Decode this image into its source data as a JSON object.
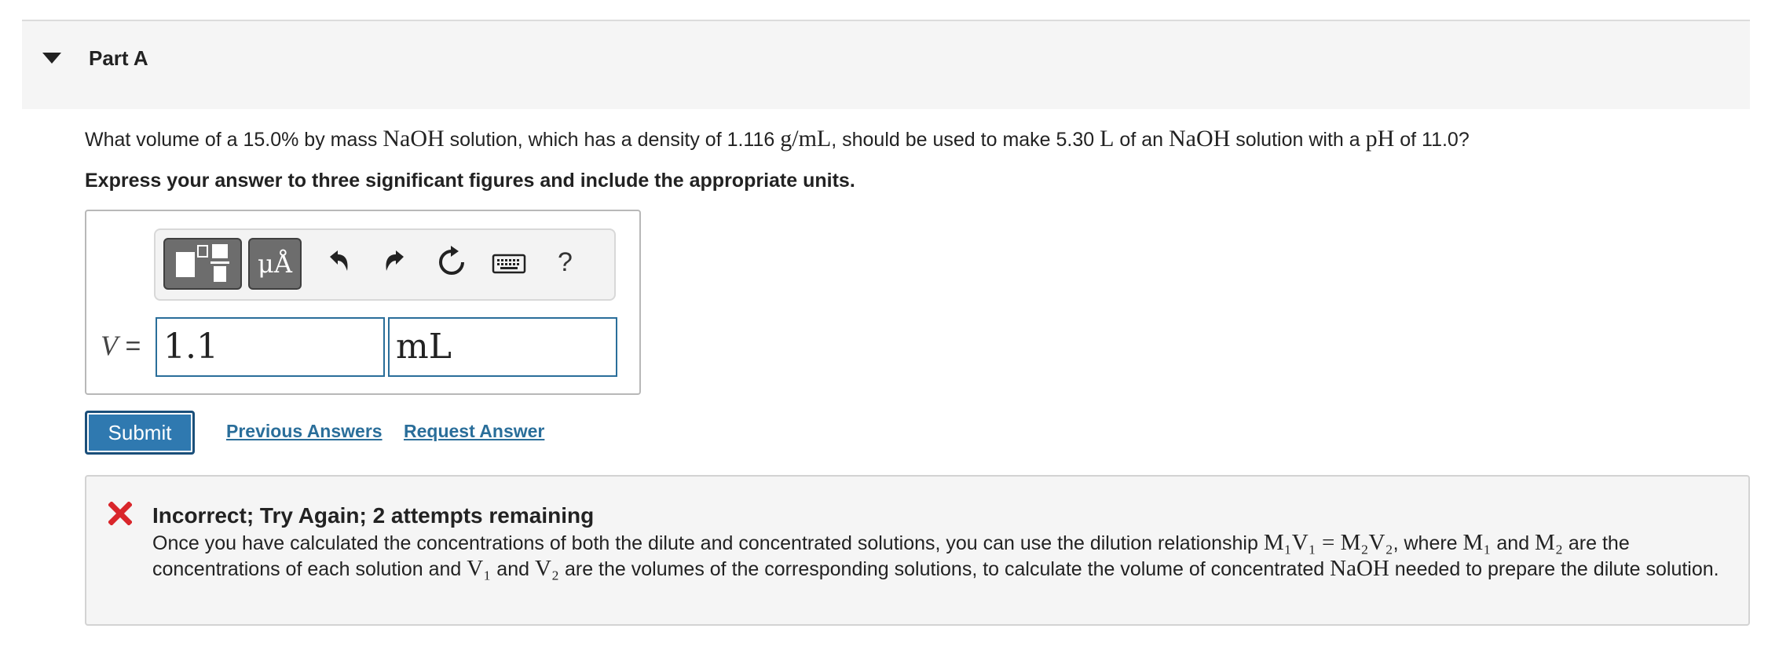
{
  "part": {
    "title": "Part A"
  },
  "question": {
    "t1": "What volume of a 15.0% by mass ",
    "m1": "NaOH",
    "t2": " solution, which has a density of 1.116 ",
    "m2": "g/mL",
    "t3": ", should be used to make 5.30 ",
    "m3": "L",
    "t4": " of an ",
    "m4": "NaOH",
    "t5": " solution with a ",
    "m5": "pH",
    "t6": " of 11.0?"
  },
  "instruction": "Express your answer to three significant figures and include the appropriate units.",
  "toolbar": {
    "units_label": "μÅ",
    "help_label": "?",
    "icons": [
      "templates-icon",
      "units-icon",
      "undo-icon",
      "redo-icon",
      "reset-icon",
      "keyboard-icon",
      "help-icon"
    ]
  },
  "answer": {
    "variable": "V",
    "equals": " = ",
    "value": "1.1",
    "unit": "mL"
  },
  "actions": {
    "submit_label": "Submit",
    "previous_answers_label": "Previous Answers",
    "request_answer_label": "Request Answer"
  },
  "feedback": {
    "title": "Incorrect; Try Again; 2 attempts remaining",
    "b1": "Once you have calculated the concentrations of both the dilute and concentrated solutions, you can use the dilution relationship ",
    "eq": "M₁V₁ = M₂V₂",
    "b2": ", where ",
    "m1": "M₁",
    "b3": " and ",
    "m2": "M₂",
    "b4": " are the concentrations of each solution and ",
    "v1": "V₁",
    "b5": " and ",
    "v2": "V₂",
    "b6": " are the volumes of the corresponding solutions, to calculate the volume of concentrated ",
    "naoh": "NaOH",
    "b7": " needed to prepare the dilute solution."
  },
  "colors": {
    "accent": "#2f79b0",
    "link": "#2a6e9a",
    "error": "#d9262b",
    "panel_bg": "#f5f5f5"
  }
}
